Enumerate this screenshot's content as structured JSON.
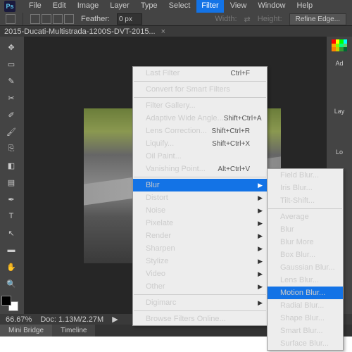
{
  "logo": "Ps",
  "menubar": [
    "File",
    "Edit",
    "Image",
    "Layer",
    "Type",
    "Select",
    "Filter",
    "View",
    "Window",
    "Help"
  ],
  "active_menu_index": 6,
  "optbar": {
    "feather_label": "Feather:",
    "feather_value": "0 px",
    "width_label": "Width:",
    "height_label": "Height:",
    "refine_label": "Refine Edge..."
  },
  "doctab": {
    "title": "2015-Ducati-Multistrada-1200S-DVT-2015...",
    "close": "×"
  },
  "filter_menu": [
    {
      "label": "Last Filter",
      "shortcut": "Ctrl+F",
      "disabled": true
    },
    {
      "sep": true
    },
    {
      "label": "Convert for Smart Filters"
    },
    {
      "sep": true
    },
    {
      "label": "Filter Gallery..."
    },
    {
      "label": "Adaptive Wide Angle...",
      "shortcut": "Shift+Ctrl+A"
    },
    {
      "label": "Lens Correction...",
      "shortcut": "Shift+Ctrl+R"
    },
    {
      "label": "Liquify...",
      "shortcut": "Shift+Ctrl+X"
    },
    {
      "label": "Oil Paint..."
    },
    {
      "label": "Vanishing Point...",
      "shortcut": "Alt+Ctrl+V"
    },
    {
      "sep": true
    },
    {
      "label": "Blur",
      "sub": true,
      "hi": true
    },
    {
      "label": "Distort",
      "sub": true
    },
    {
      "label": "Noise",
      "sub": true
    },
    {
      "label": "Pixelate",
      "sub": true
    },
    {
      "label": "Render",
      "sub": true
    },
    {
      "label": "Sharpen",
      "sub": true
    },
    {
      "label": "Stylize",
      "sub": true
    },
    {
      "label": "Video",
      "sub": true
    },
    {
      "label": "Other",
      "sub": true
    },
    {
      "sep": true
    },
    {
      "label": "Digimarc",
      "sub": true
    },
    {
      "sep": true
    },
    {
      "label": "Browse Filters Online..."
    }
  ],
  "blur_menu": [
    {
      "label": "Field Blur..."
    },
    {
      "label": "Iris Blur..."
    },
    {
      "label": "Tilt-Shift..."
    },
    {
      "sep": true
    },
    {
      "label": "Average"
    },
    {
      "label": "Blur"
    },
    {
      "label": "Blur More"
    },
    {
      "label": "Box Blur..."
    },
    {
      "label": "Gaussian Blur..."
    },
    {
      "label": "Lens Blur..."
    },
    {
      "label": "Motion Blur...",
      "hi": true
    },
    {
      "label": "Radial Blur..."
    },
    {
      "label": "Shape Blur..."
    },
    {
      "label": "Smart Blur..."
    },
    {
      "label": "Surface Blur..."
    }
  ],
  "swatch_colors": [
    "#ff0000",
    "#ffff00",
    "#00ff00",
    "#00ffff",
    "#ffa500",
    "#80ff00",
    "#00ff80",
    "#66cc66",
    "#ff8000",
    "#cccc00",
    "#339933",
    "#006633"
  ],
  "panel_labels": {
    "ad": "Ad",
    "lay": "Lay",
    "lo": "Lo"
  },
  "status": {
    "zoom": "66.67%",
    "doc": "Doc: 1.13M/2.27M",
    "arrow": "▶"
  },
  "tabs": {
    "mini": "Mini Bridge",
    "timeline": "Timeline"
  }
}
